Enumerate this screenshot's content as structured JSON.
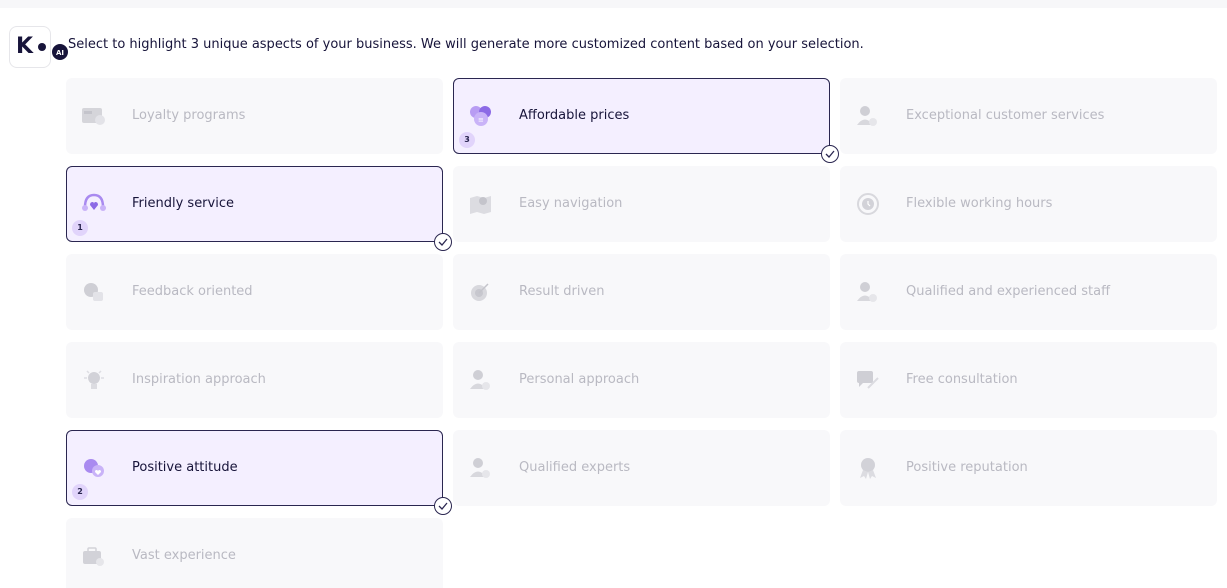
{
  "header": {
    "logo_letter": "K",
    "ai_badge": "AI",
    "instruction": "Select to highlight 3 unique aspects of your business. We will generate more customized content based on your selection."
  },
  "aspects": [
    {
      "label": "Loyalty programs",
      "icon": "gift-card-icon",
      "selected": false
    },
    {
      "label": "Affordable prices",
      "icon": "coins-icon",
      "selected": true,
      "order": "3"
    },
    {
      "label": "Exceptional customer services",
      "icon": "person-badge-icon",
      "selected": false
    },
    {
      "label": "Friendly service",
      "icon": "headset-heart-icon",
      "selected": true,
      "order": "1"
    },
    {
      "label": "Easy navigation",
      "icon": "map-pin-icon",
      "selected": false
    },
    {
      "label": "Flexible working hours",
      "icon": "clock-icon",
      "selected": false
    },
    {
      "label": "Feedback oriented",
      "icon": "feedback-icon",
      "selected": false
    },
    {
      "label": "Result driven",
      "icon": "target-icon",
      "selected": false
    },
    {
      "label": "Qualified and experienced staff",
      "icon": "person-badge-icon",
      "selected": false
    },
    {
      "label": "Inspiration approach",
      "icon": "lightbulb-icon",
      "selected": false
    },
    {
      "label": "Personal approach",
      "icon": "person-check-icon",
      "selected": false
    },
    {
      "label": "Free consultation",
      "icon": "chat-icon",
      "selected": false
    },
    {
      "label": "Positive attitude",
      "icon": "heart-chat-icon",
      "selected": true,
      "order": "2"
    },
    {
      "label": "Qualified experts",
      "icon": "person-badge-icon",
      "selected": false
    },
    {
      "label": "Positive reputation",
      "icon": "medal-icon",
      "selected": false
    },
    {
      "label": "Vast experience",
      "icon": "briefcase-icon",
      "selected": false
    }
  ],
  "colors": {
    "selected_bg": "#f4efff",
    "selected_border": "#2a2650",
    "unselected_bg": "#f8f8fa",
    "unselected_text": "#b9b9c2",
    "accent": "#a98af0"
  }
}
